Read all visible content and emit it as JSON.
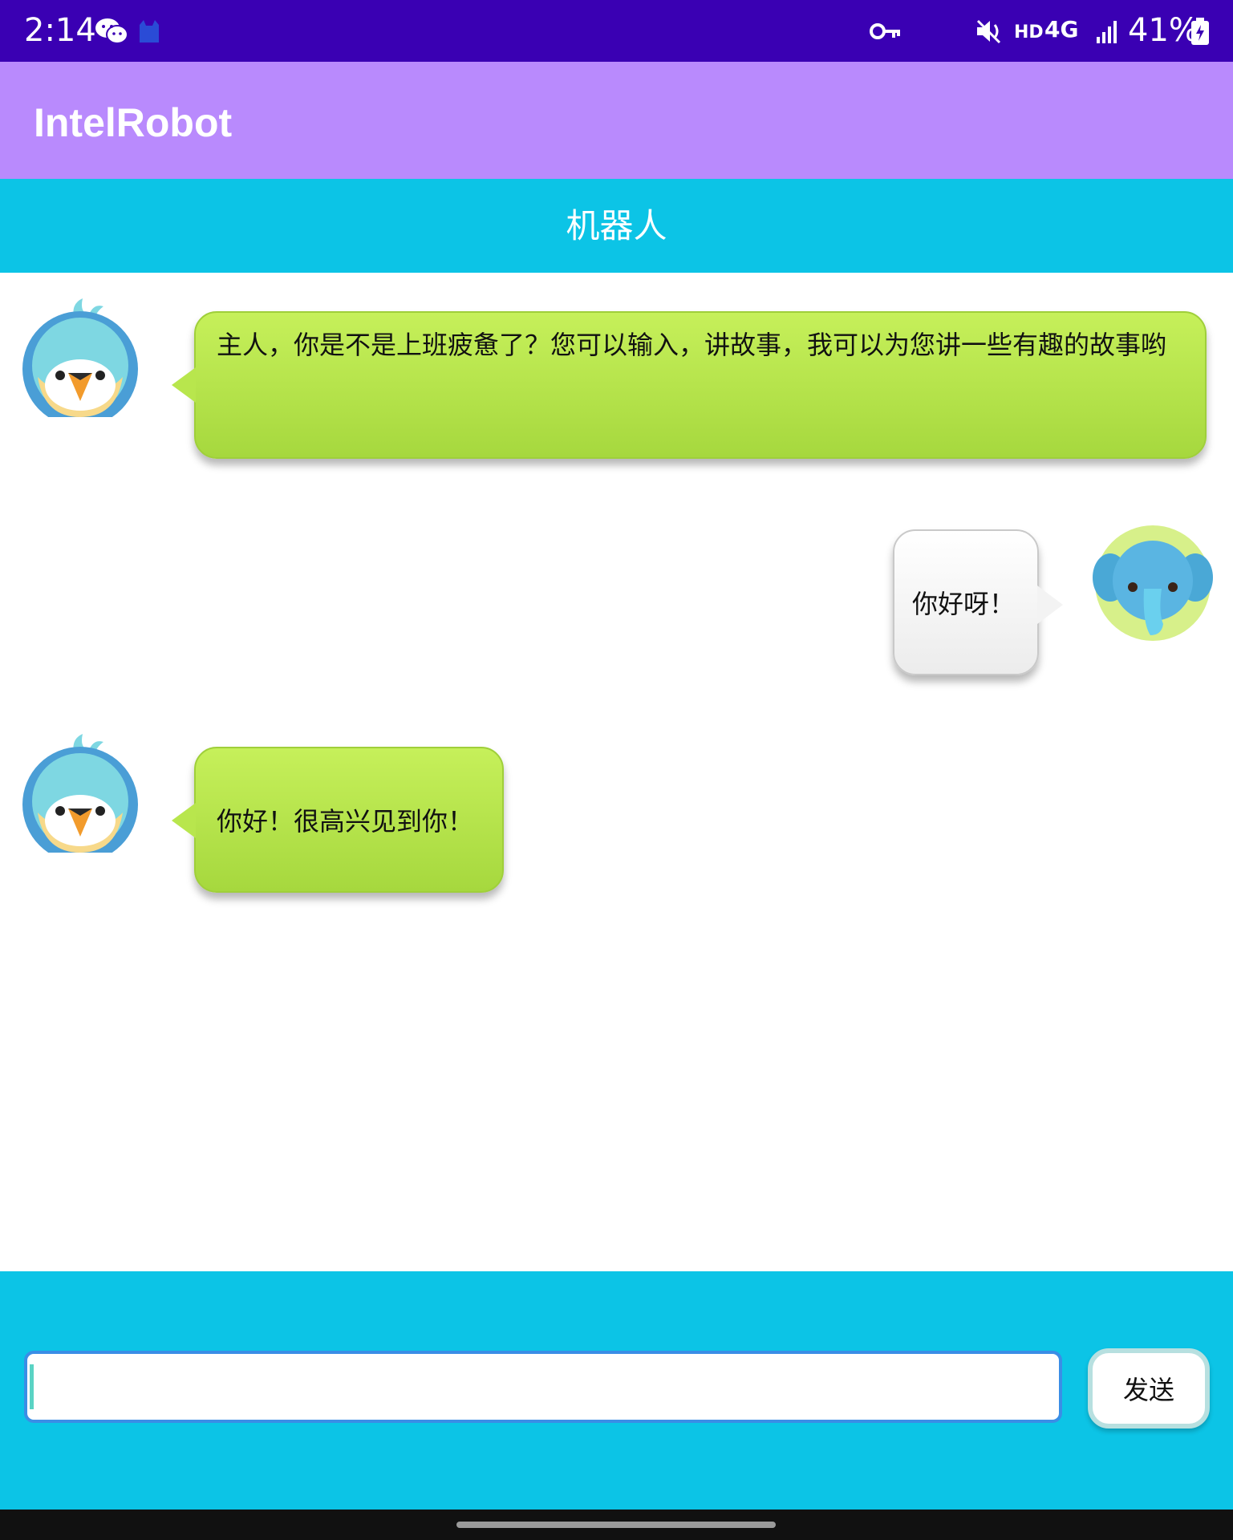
{
  "status_bar": {
    "time": "2:14",
    "battery": "41%",
    "network": "4G",
    "hd": "HD",
    "icons": [
      "wechat-icon",
      "cat-icon",
      "vpn-key-icon",
      "mute-icon",
      "signal-icon",
      "battery-charging-icon"
    ]
  },
  "app_bar": {
    "title": "IntelRobot"
  },
  "chat_header": {
    "title": "机器人"
  },
  "messages": [
    {
      "sender": "robot",
      "avatar": "bird-avatar",
      "text": "主人，你是不是上班疲惫了？您可以输入，讲故事，我可以为您讲一些有趣的故事哟"
    },
    {
      "sender": "user",
      "avatar": "elephant-avatar",
      "text": "你好呀！"
    },
    {
      "sender": "robot",
      "avatar": "bird-avatar",
      "text": "你好！很高兴见到你！"
    }
  ],
  "composer": {
    "input_value": "",
    "send_label": "发送"
  },
  "colors": {
    "status_bar": "#3a00b3",
    "app_bar": "#b98afd",
    "header": "#0cc4e6",
    "robot_bubble": "#b8e64d",
    "user_bubble": "#f3f3f3",
    "input_border": "#3a8ee6"
  }
}
